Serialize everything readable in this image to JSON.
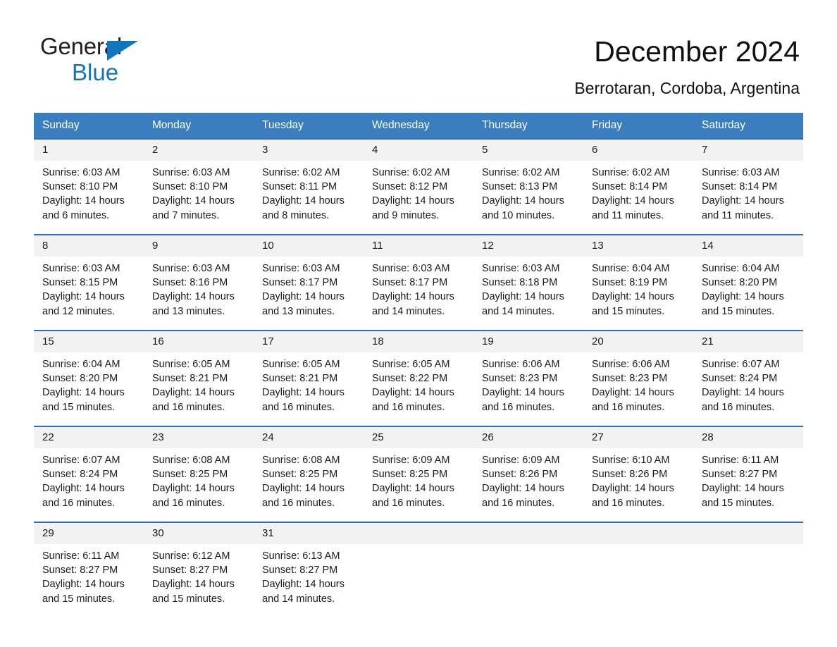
{
  "brand": {
    "name_part1": "General",
    "name_part2": "Blue",
    "triangle_icon": "brand-triangle-icon",
    "colors": {
      "black": "#231f20",
      "blue": "#1175bb"
    }
  },
  "header": {
    "title": "December 2024",
    "subtitle": "Berrotaran, Cordoba, Argentina"
  },
  "theme": {
    "header_bar": "#3a7ebf",
    "row_divider": "#2f6fae",
    "date_band": "#f2f2f2",
    "text": "#1a1a1a",
    "page_bg": "#ffffff"
  },
  "weekdays": [
    "Sunday",
    "Monday",
    "Tuesday",
    "Wednesday",
    "Thursday",
    "Friday",
    "Saturday"
  ],
  "weeks": [
    [
      {
        "date": "1",
        "sunrise": "Sunrise: 6:03 AM",
        "sunset": "Sunset: 8:10 PM",
        "daylight1": "Daylight: 14 hours",
        "daylight2": "and 6 minutes."
      },
      {
        "date": "2",
        "sunrise": "Sunrise: 6:03 AM",
        "sunset": "Sunset: 8:10 PM",
        "daylight1": "Daylight: 14 hours",
        "daylight2": "and 7 minutes."
      },
      {
        "date": "3",
        "sunrise": "Sunrise: 6:02 AM",
        "sunset": "Sunset: 8:11 PM",
        "daylight1": "Daylight: 14 hours",
        "daylight2": "and 8 minutes."
      },
      {
        "date": "4",
        "sunrise": "Sunrise: 6:02 AM",
        "sunset": "Sunset: 8:12 PM",
        "daylight1": "Daylight: 14 hours",
        "daylight2": "and 9 minutes."
      },
      {
        "date": "5",
        "sunrise": "Sunrise: 6:02 AM",
        "sunset": "Sunset: 8:13 PM",
        "daylight1": "Daylight: 14 hours",
        "daylight2": "and 10 minutes."
      },
      {
        "date": "6",
        "sunrise": "Sunrise: 6:02 AM",
        "sunset": "Sunset: 8:14 PM",
        "daylight1": "Daylight: 14 hours",
        "daylight2": "and 11 minutes."
      },
      {
        "date": "7",
        "sunrise": "Sunrise: 6:03 AM",
        "sunset": "Sunset: 8:14 PM",
        "daylight1": "Daylight: 14 hours",
        "daylight2": "and 11 minutes."
      }
    ],
    [
      {
        "date": "8",
        "sunrise": "Sunrise: 6:03 AM",
        "sunset": "Sunset: 8:15 PM",
        "daylight1": "Daylight: 14 hours",
        "daylight2": "and 12 minutes."
      },
      {
        "date": "9",
        "sunrise": "Sunrise: 6:03 AM",
        "sunset": "Sunset: 8:16 PM",
        "daylight1": "Daylight: 14 hours",
        "daylight2": "and 13 minutes."
      },
      {
        "date": "10",
        "sunrise": "Sunrise: 6:03 AM",
        "sunset": "Sunset: 8:17 PM",
        "daylight1": "Daylight: 14 hours",
        "daylight2": "and 13 minutes."
      },
      {
        "date": "11",
        "sunrise": "Sunrise: 6:03 AM",
        "sunset": "Sunset: 8:17 PM",
        "daylight1": "Daylight: 14 hours",
        "daylight2": "and 14 minutes."
      },
      {
        "date": "12",
        "sunrise": "Sunrise: 6:03 AM",
        "sunset": "Sunset: 8:18 PM",
        "daylight1": "Daylight: 14 hours",
        "daylight2": "and 14 minutes."
      },
      {
        "date": "13",
        "sunrise": "Sunrise: 6:04 AM",
        "sunset": "Sunset: 8:19 PM",
        "daylight1": "Daylight: 14 hours",
        "daylight2": "and 15 minutes."
      },
      {
        "date": "14",
        "sunrise": "Sunrise: 6:04 AM",
        "sunset": "Sunset: 8:20 PM",
        "daylight1": "Daylight: 14 hours",
        "daylight2": "and 15 minutes."
      }
    ],
    [
      {
        "date": "15",
        "sunrise": "Sunrise: 6:04 AM",
        "sunset": "Sunset: 8:20 PM",
        "daylight1": "Daylight: 14 hours",
        "daylight2": "and 15 minutes."
      },
      {
        "date": "16",
        "sunrise": "Sunrise: 6:05 AM",
        "sunset": "Sunset: 8:21 PM",
        "daylight1": "Daylight: 14 hours",
        "daylight2": "and 16 minutes."
      },
      {
        "date": "17",
        "sunrise": "Sunrise: 6:05 AM",
        "sunset": "Sunset: 8:21 PM",
        "daylight1": "Daylight: 14 hours",
        "daylight2": "and 16 minutes."
      },
      {
        "date": "18",
        "sunrise": "Sunrise: 6:05 AM",
        "sunset": "Sunset: 8:22 PM",
        "daylight1": "Daylight: 14 hours",
        "daylight2": "and 16 minutes."
      },
      {
        "date": "19",
        "sunrise": "Sunrise: 6:06 AM",
        "sunset": "Sunset: 8:23 PM",
        "daylight1": "Daylight: 14 hours",
        "daylight2": "and 16 minutes."
      },
      {
        "date": "20",
        "sunrise": "Sunrise: 6:06 AM",
        "sunset": "Sunset: 8:23 PM",
        "daylight1": "Daylight: 14 hours",
        "daylight2": "and 16 minutes."
      },
      {
        "date": "21",
        "sunrise": "Sunrise: 6:07 AM",
        "sunset": "Sunset: 8:24 PM",
        "daylight1": "Daylight: 14 hours",
        "daylight2": "and 16 minutes."
      }
    ],
    [
      {
        "date": "22",
        "sunrise": "Sunrise: 6:07 AM",
        "sunset": "Sunset: 8:24 PM",
        "daylight1": "Daylight: 14 hours",
        "daylight2": "and 16 minutes."
      },
      {
        "date": "23",
        "sunrise": "Sunrise: 6:08 AM",
        "sunset": "Sunset: 8:25 PM",
        "daylight1": "Daylight: 14 hours",
        "daylight2": "and 16 minutes."
      },
      {
        "date": "24",
        "sunrise": "Sunrise: 6:08 AM",
        "sunset": "Sunset: 8:25 PM",
        "daylight1": "Daylight: 14 hours",
        "daylight2": "and 16 minutes."
      },
      {
        "date": "25",
        "sunrise": "Sunrise: 6:09 AM",
        "sunset": "Sunset: 8:25 PM",
        "daylight1": "Daylight: 14 hours",
        "daylight2": "and 16 minutes."
      },
      {
        "date": "26",
        "sunrise": "Sunrise: 6:09 AM",
        "sunset": "Sunset: 8:26 PM",
        "daylight1": "Daylight: 14 hours",
        "daylight2": "and 16 minutes."
      },
      {
        "date": "27",
        "sunrise": "Sunrise: 6:10 AM",
        "sunset": "Sunset: 8:26 PM",
        "daylight1": "Daylight: 14 hours",
        "daylight2": "and 16 minutes."
      },
      {
        "date": "28",
        "sunrise": "Sunrise: 6:11 AM",
        "sunset": "Sunset: 8:27 PM",
        "daylight1": "Daylight: 14 hours",
        "daylight2": "and 15 minutes."
      }
    ],
    [
      {
        "date": "29",
        "sunrise": "Sunrise: 6:11 AM",
        "sunset": "Sunset: 8:27 PM",
        "daylight1": "Daylight: 14 hours",
        "daylight2": "and 15 minutes."
      },
      {
        "date": "30",
        "sunrise": "Sunrise: 6:12 AM",
        "sunset": "Sunset: 8:27 PM",
        "daylight1": "Daylight: 14 hours",
        "daylight2": "and 15 minutes."
      },
      {
        "date": "31",
        "sunrise": "Sunrise: 6:13 AM",
        "sunset": "Sunset: 8:27 PM",
        "daylight1": "Daylight: 14 hours",
        "daylight2": "and 14 minutes."
      },
      {
        "date": "",
        "sunrise": "",
        "sunset": "",
        "daylight1": "",
        "daylight2": ""
      },
      {
        "date": "",
        "sunrise": "",
        "sunset": "",
        "daylight1": "",
        "daylight2": ""
      },
      {
        "date": "",
        "sunrise": "",
        "sunset": "",
        "daylight1": "",
        "daylight2": ""
      },
      {
        "date": "",
        "sunrise": "",
        "sunset": "",
        "daylight1": "",
        "daylight2": ""
      }
    ]
  ]
}
